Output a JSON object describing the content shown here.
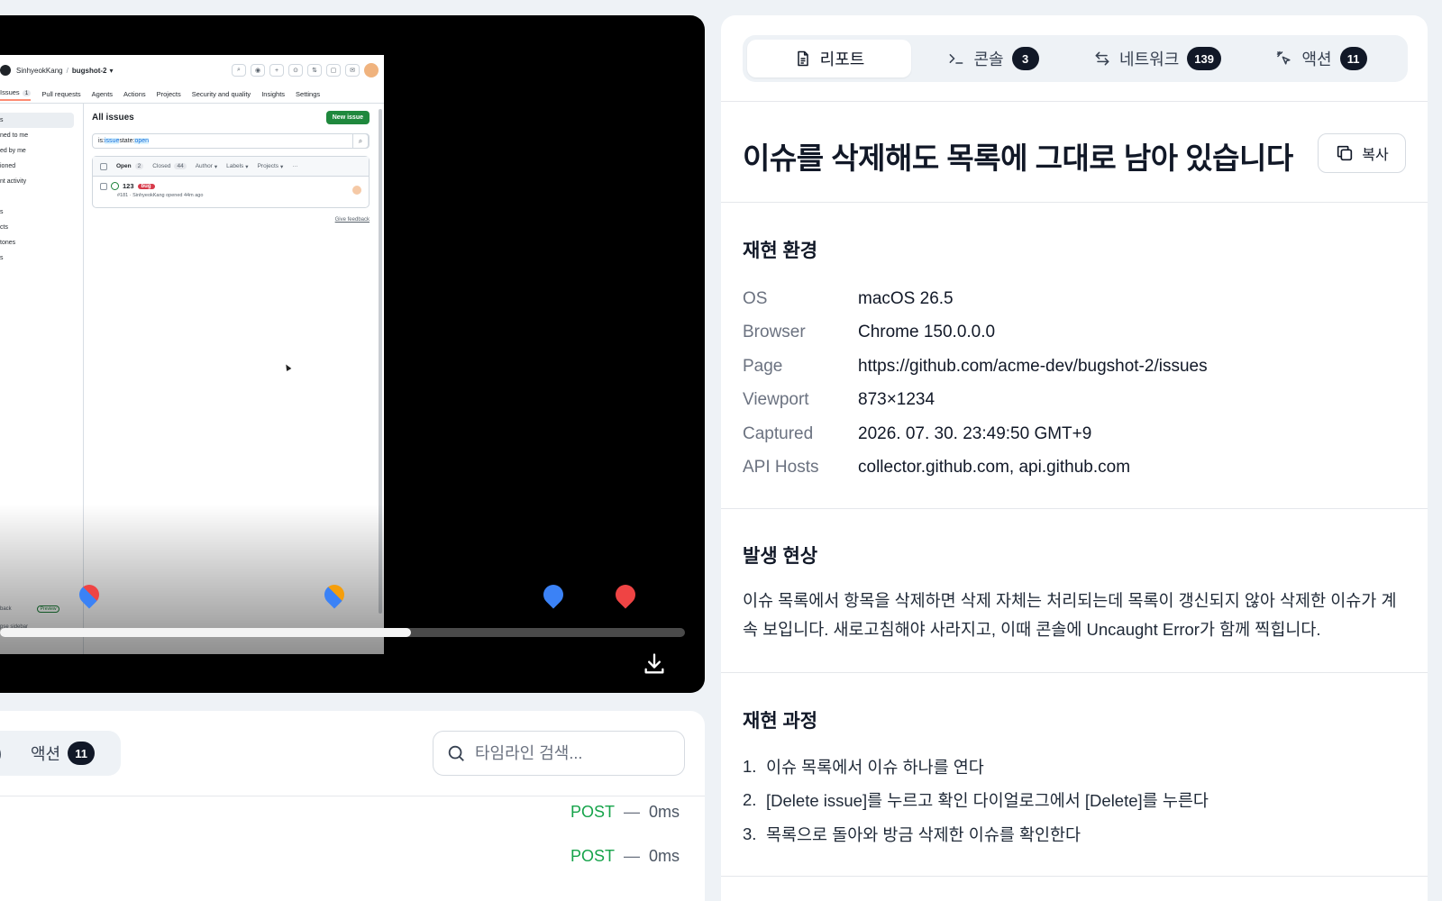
{
  "video": {
    "screenshot": {
      "owner": "SinhyeokKang",
      "repo": "bugshot-2",
      "nav": [
        {
          "label": "Issues",
          "count": "1",
          "active": true
        },
        {
          "label": "Pull requests"
        },
        {
          "label": "Agents"
        },
        {
          "label": "Actions"
        },
        {
          "label": "Projects"
        },
        {
          "label": "Security and quality"
        },
        {
          "label": "Insights"
        },
        {
          "label": "Settings"
        }
      ],
      "sidebar": [
        "s",
        "ned to me",
        "ed by me",
        "ioned",
        "nt activity",
        "",
        "s",
        "cts",
        "tones",
        "s"
      ],
      "heading": "All issues",
      "new_issue": "New issue",
      "search_prefix": "is:",
      "search_issue": "issue",
      "search_mid": " state:",
      "search_open": "open",
      "list_head": {
        "open": "Open",
        "open_count": "2",
        "closed": "Closed",
        "closed_count": "44",
        "author": "Author",
        "labels": "Labels",
        "projects": "Projects"
      },
      "issue": {
        "title": "123",
        "label": "bug",
        "meta": "#181 · SinhyeokKang opened 44m ago"
      },
      "feedback": "Give feedback",
      "bottom": [
        {
          "label": "back",
          "pill": "Preview"
        },
        {
          "label": "pse sidebar"
        }
      ]
    },
    "progress": 0.6,
    "markers": [
      {
        "color": "#3b82f6",
        "accent": "#ef4444"
      },
      {
        "color": "#3b82f6",
        "accent": "#f59e0b"
      },
      {
        "color": "#3b82f6",
        "accent": null
      },
      {
        "color": "#ef4444",
        "accent": null
      }
    ]
  },
  "timeline": {
    "prev_tab_partial": ")",
    "tab_label": "액션",
    "tab_count": "11",
    "search_placeholder": "타임라인 검색...",
    "rows": [
      {
        "method": "POST",
        "dash": "—",
        "duration": "0ms"
      },
      {
        "method": "POST",
        "dash": "—",
        "duration": "0ms"
      }
    ]
  },
  "tabs": [
    {
      "label": "리포트",
      "count": null,
      "icon": "document-icon",
      "active": true
    },
    {
      "label": "콘솔",
      "count": "3",
      "icon": "terminal-icon",
      "active": false
    },
    {
      "label": "네트워크",
      "count": "139",
      "icon": "arrows-swap-icon",
      "active": false
    },
    {
      "label": "액션",
      "count": "11",
      "icon": "pointer-click-icon",
      "active": false
    }
  ],
  "report": {
    "title": "이슈를 삭제해도 목록에 그대로 남아 있습니다",
    "copy_label": "복사",
    "env_title": "재현 환경",
    "env": [
      {
        "key": "OS",
        "value": "macOS 26.5"
      },
      {
        "key": "Browser",
        "value": "Chrome 150.0.0.0"
      },
      {
        "key": "Page",
        "value": "https://github.com/acme-dev/bugshot-2/issues"
      },
      {
        "key": "Viewport",
        "value": "873×1234"
      },
      {
        "key": "Captured",
        "value": "2026. 07. 30. 23:49:50 GMT+9"
      },
      {
        "key": "API Hosts",
        "value": "collector.github.com, api.github.com"
      }
    ],
    "symptom_title": "발생 현상",
    "symptom_text": "이슈 목록에서 항목을 삭제하면 삭제 자체는 처리되는데 목록이 갱신되지 않아 삭제한 이슈가 계속 보입니다. 새로고침해야 사라지고, 이때 콘솔에 Uncaught Error가 함께 찍힙니다.",
    "steps_title": "재현 과정",
    "steps": [
      "이슈 목록에서 이슈 하나를 연다",
      "[Delete issue]를 누르고 확인 다이얼로그에서 [Delete]를 누른다",
      "목록으로 돌아와 방금 삭제한 이슈를 확인한다"
    ]
  }
}
